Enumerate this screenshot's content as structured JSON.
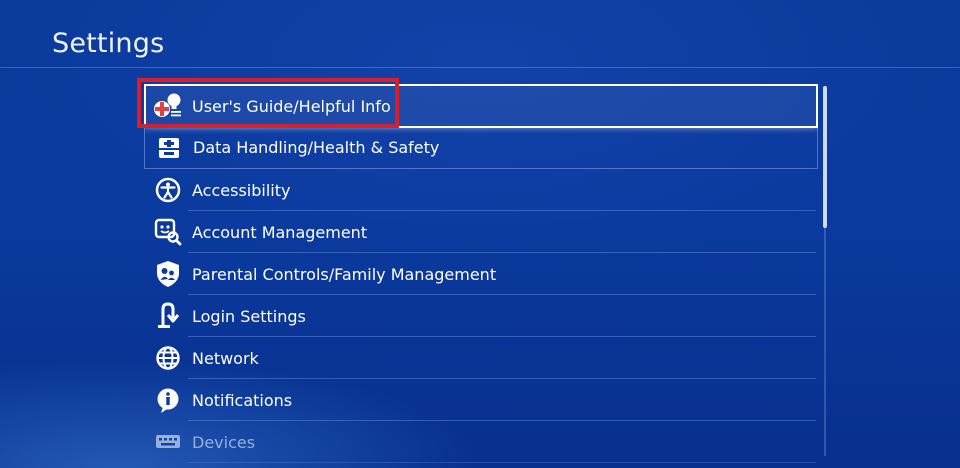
{
  "header": {
    "title": "Settings"
  },
  "menu": {
    "items": [
      {
        "label": "User's Guide/Helpful Info",
        "icon": "guide-bulb-icon"
      },
      {
        "label": "Data Handling/Health & Safety",
        "icon": "health-safety-icon"
      },
      {
        "label": "Accessibility",
        "icon": "accessibility-icon"
      },
      {
        "label": "Account Management",
        "icon": "account-management-icon"
      },
      {
        "label": "Parental Controls/Family Management",
        "icon": "parental-controls-icon"
      },
      {
        "label": "Login Settings",
        "icon": "login-settings-icon"
      },
      {
        "label": "Network",
        "icon": "network-globe-icon"
      },
      {
        "label": "Notifications",
        "icon": "notifications-icon"
      },
      {
        "label": "Devices",
        "icon": "devices-keyboard-icon"
      }
    ]
  },
  "colors": {
    "background": "#0b3a9c",
    "highlight_frame": "#d7202e",
    "text": "#ffffff"
  }
}
